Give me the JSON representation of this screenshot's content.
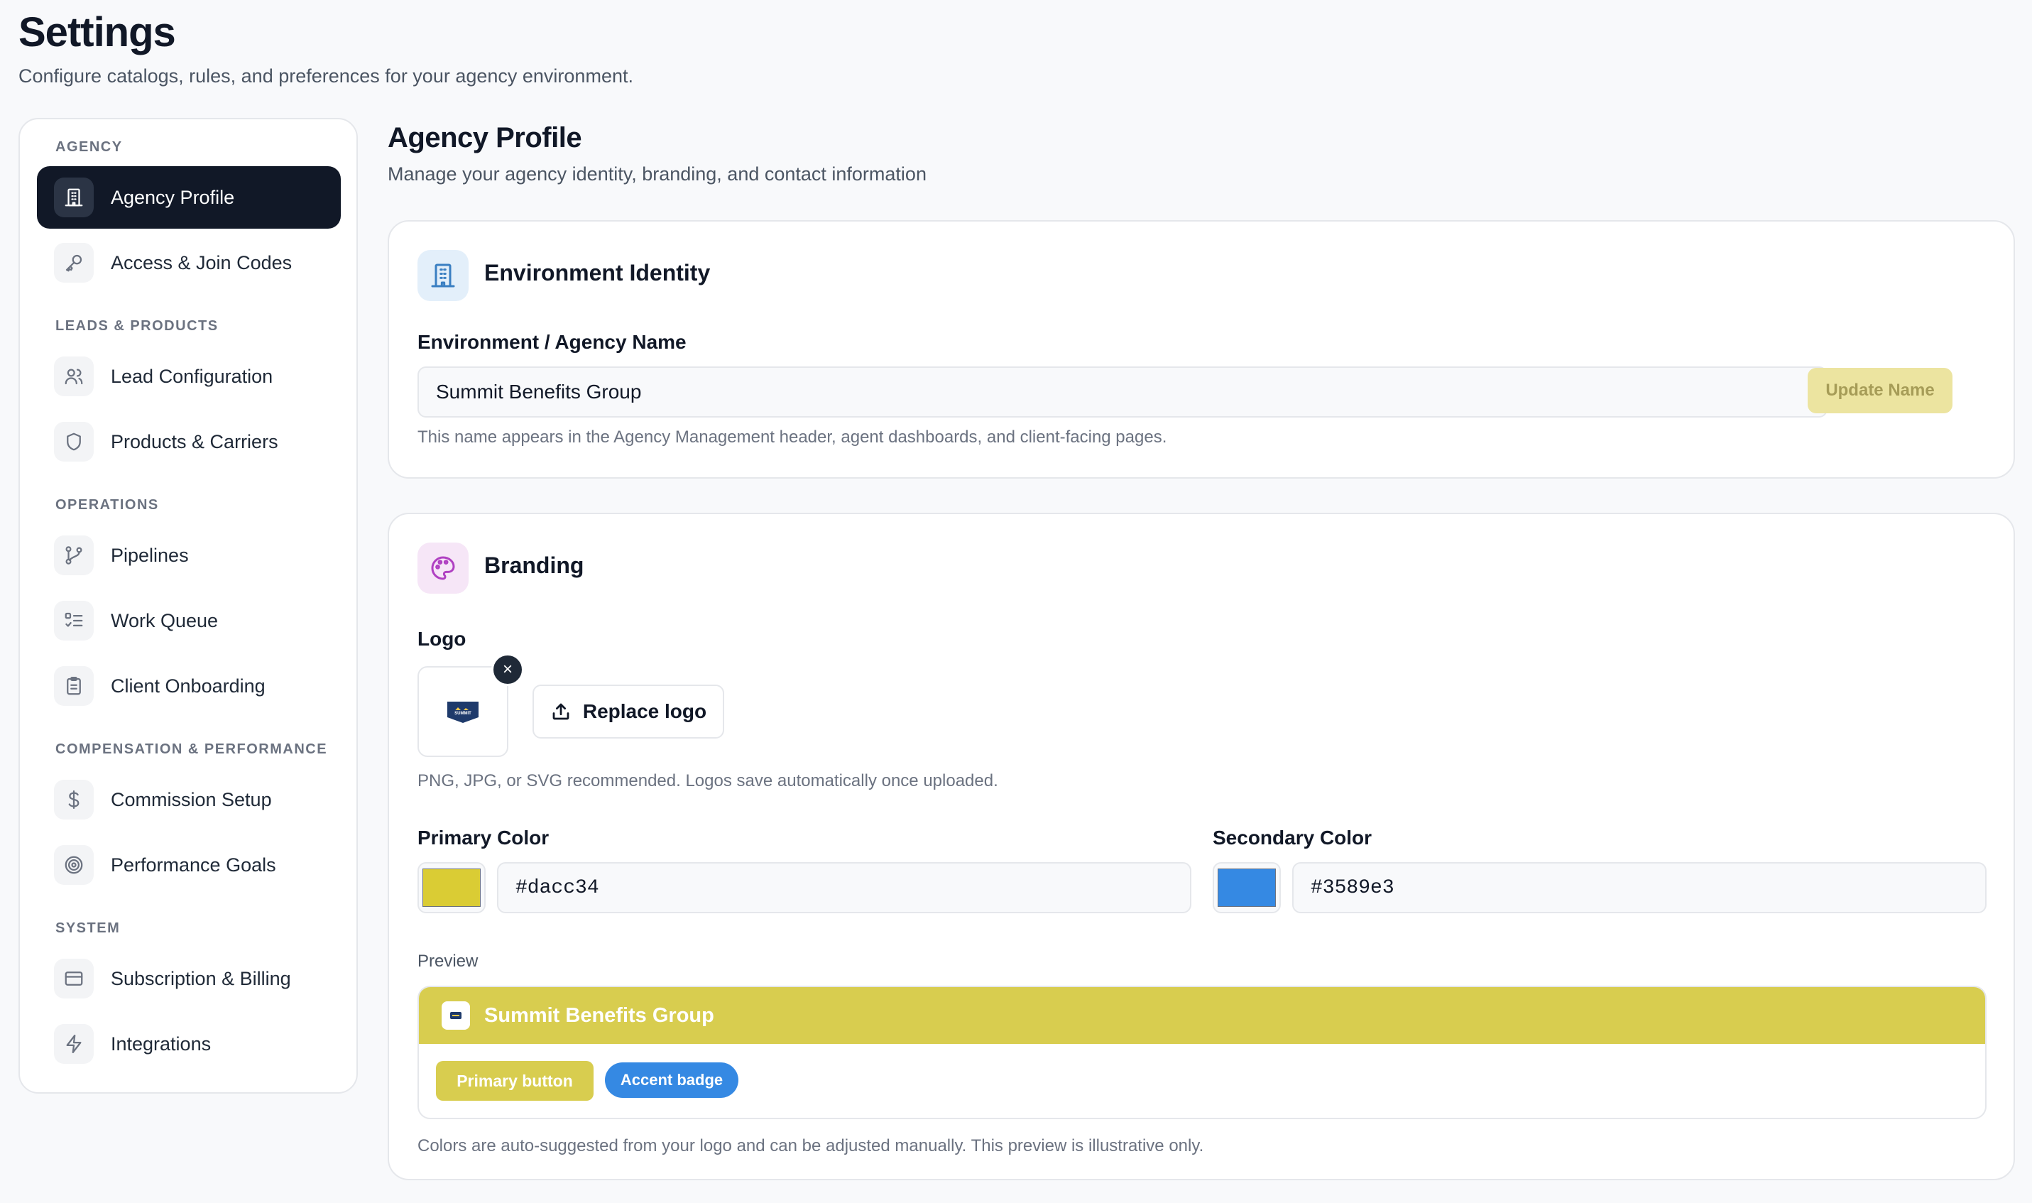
{
  "page": {
    "title": "Settings",
    "subtitle": "Configure catalogs, rules, and preferences for your agency environment."
  },
  "sidebar": {
    "sections": [
      {
        "label": "AGENCY",
        "items": [
          {
            "label": "Agency Profile",
            "icon": "building-icon",
            "active": true
          },
          {
            "label": "Access & Join Codes",
            "icon": "key-icon"
          }
        ]
      },
      {
        "label": "LEADS & PRODUCTS",
        "items": [
          {
            "label": "Lead Configuration",
            "icon": "users-icon"
          },
          {
            "label": "Products & Carriers",
            "icon": "shield-icon"
          }
        ]
      },
      {
        "label": "OPERATIONS",
        "items": [
          {
            "label": "Pipelines",
            "icon": "git-branch-icon"
          },
          {
            "label": "Work Queue",
            "icon": "list-checks-icon"
          },
          {
            "label": "Client Onboarding",
            "icon": "clipboard-icon"
          }
        ]
      },
      {
        "label": "COMPENSATION & PERFORMANCE",
        "items": [
          {
            "label": "Commission Setup",
            "icon": "dollar-icon"
          },
          {
            "label": "Performance Goals",
            "icon": "target-icon"
          }
        ]
      },
      {
        "label": "SYSTEM",
        "items": [
          {
            "label": "Subscription & Billing",
            "icon": "credit-card-icon"
          },
          {
            "label": "Integrations",
            "icon": "zap-icon"
          }
        ]
      }
    ]
  },
  "main": {
    "title": "Agency Profile",
    "subtitle": "Manage your agency identity, branding, and contact information"
  },
  "identity": {
    "title": "Environment Identity",
    "name_label": "Environment / Agency Name",
    "name_value": "Summit Benefits Group",
    "update_button": "Update Name",
    "help": "This name appears in the Agency Management header, agent dashboards, and client-facing pages."
  },
  "branding": {
    "title": "Branding",
    "logo_label": "Logo",
    "logo_text": "SUMMIT",
    "remove_icon": "×",
    "replace_button": "Replace logo",
    "logo_help": "PNG, JPG, or SVG recommended. Logos save automatically once uploaded.",
    "primary_label": "Primary Color",
    "primary_value": "#dacc34",
    "secondary_label": "Secondary Color",
    "secondary_value": "#3589e3",
    "preview_label": "Preview",
    "preview_name": "Summit Benefits Group",
    "preview_primary_button": "Primary button",
    "preview_badge": "Accent badge",
    "preview_help": "Colors are auto-suggested from your logo and can be adjusted manually. This preview is illustrative only."
  },
  "colors": {
    "primary": "#dacc34",
    "secondary": "#3589e3",
    "sidebar_active": "#111827"
  }
}
